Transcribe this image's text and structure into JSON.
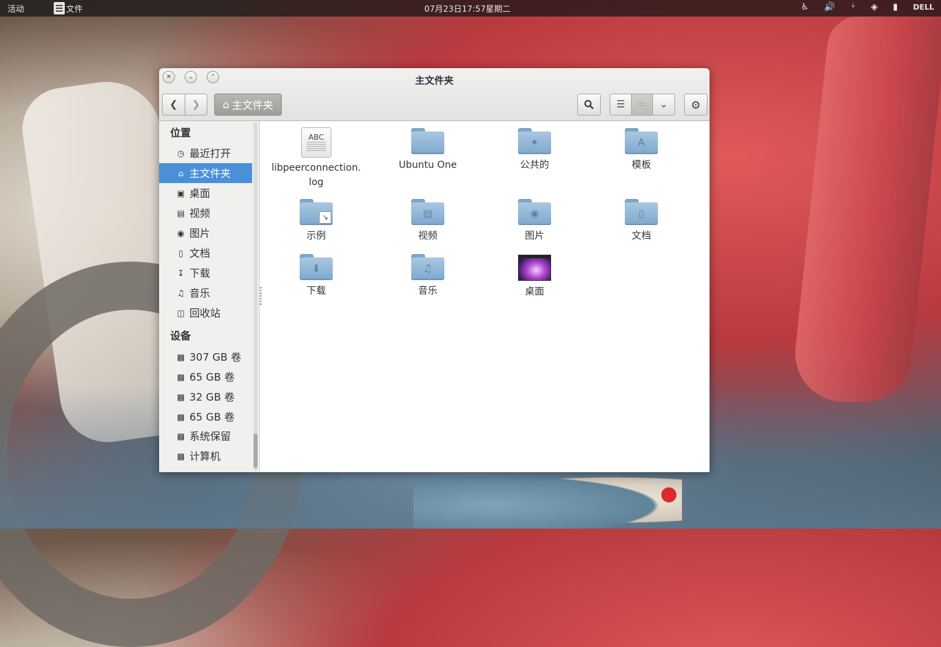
{
  "topbar": {
    "activities": "活动",
    "app_name": "文件",
    "clock": "07月23日17:57星期二",
    "tray": {
      "accessibility_icon": "accessibility-icon",
      "volume_icon": "volume-icon",
      "bluetooth_icon": "bluetooth-icon",
      "wifi_icon": "wifi-icon",
      "battery_icon": "battery-icon",
      "user_label": "DELL"
    }
  },
  "window": {
    "title": "主文件夹",
    "breadcrumb": "主文件夹"
  },
  "sidebar": {
    "places_heading": "位置",
    "places": [
      {
        "label": "最近打开",
        "icon": "clock-icon"
      },
      {
        "label": "主文件夹",
        "icon": "home-icon",
        "active": true
      },
      {
        "label": "桌面",
        "icon": "desktop-icon"
      },
      {
        "label": "视频",
        "icon": "film-icon"
      },
      {
        "label": "图片",
        "icon": "camera-icon"
      },
      {
        "label": "文档",
        "icon": "document-icon"
      },
      {
        "label": "下载",
        "icon": "download-icon"
      },
      {
        "label": "音乐",
        "icon": "music-icon"
      },
      {
        "label": "回收站",
        "icon": "trash-icon"
      }
    ],
    "devices_heading": "设备",
    "devices": [
      {
        "label": "307 GB 卷",
        "icon": "drive-icon"
      },
      {
        "label": "65 GB 卷",
        "icon": "drive-icon"
      },
      {
        "label": "32 GB 卷",
        "icon": "drive-icon"
      },
      {
        "label": "65 GB 卷",
        "icon": "drive-icon"
      },
      {
        "label": "系统保留",
        "icon": "drive-icon"
      },
      {
        "label": "计算机",
        "icon": "drive-icon"
      }
    ]
  },
  "files": [
    {
      "label": "libpeerconnection.\nlog",
      "kind": "text-file",
      "doc_text": "ABC"
    },
    {
      "label": "Ubuntu One",
      "kind": "folder"
    },
    {
      "label": "公共的",
      "kind": "folder-public"
    },
    {
      "label": "模板",
      "kind": "folder-templates"
    },
    {
      "label": "示例",
      "kind": "folder-link"
    },
    {
      "label": "视频",
      "kind": "folder-videos"
    },
    {
      "label": "图片",
      "kind": "folder-pictures"
    },
    {
      "label": "文档",
      "kind": "folder-documents"
    },
    {
      "label": "下载",
      "kind": "folder-downloads"
    },
    {
      "label": "音乐",
      "kind": "folder-music"
    },
    {
      "label": "桌面",
      "kind": "desktop-thumbnail"
    }
  ],
  "colors": {
    "selection": "#4a90d9",
    "folder": "#8fb4d6"
  }
}
